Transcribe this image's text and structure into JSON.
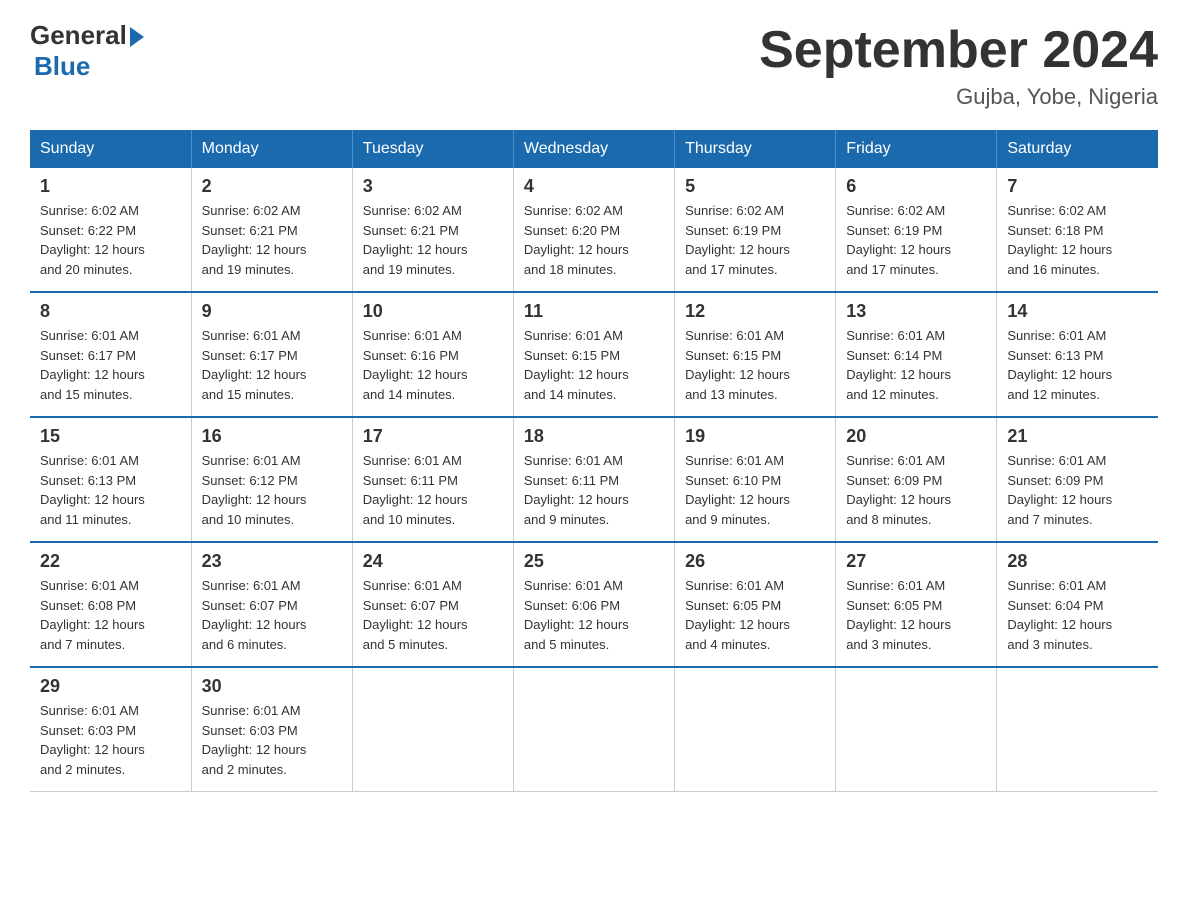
{
  "logo": {
    "general_text": "General",
    "blue_text": "Blue"
  },
  "title": "September 2024",
  "location": "Gujba, Yobe, Nigeria",
  "days_of_week": [
    "Sunday",
    "Monday",
    "Tuesday",
    "Wednesday",
    "Thursday",
    "Friday",
    "Saturday"
  ],
  "weeks": [
    [
      {
        "day": "1",
        "sunrise": "6:02 AM",
        "sunset": "6:22 PM",
        "daylight": "12 hours and 20 minutes."
      },
      {
        "day": "2",
        "sunrise": "6:02 AM",
        "sunset": "6:21 PM",
        "daylight": "12 hours and 19 minutes."
      },
      {
        "day": "3",
        "sunrise": "6:02 AM",
        "sunset": "6:21 PM",
        "daylight": "12 hours and 19 minutes."
      },
      {
        "day": "4",
        "sunrise": "6:02 AM",
        "sunset": "6:20 PM",
        "daylight": "12 hours and 18 minutes."
      },
      {
        "day": "5",
        "sunrise": "6:02 AM",
        "sunset": "6:19 PM",
        "daylight": "12 hours and 17 minutes."
      },
      {
        "day": "6",
        "sunrise": "6:02 AM",
        "sunset": "6:19 PM",
        "daylight": "12 hours and 17 minutes."
      },
      {
        "day": "7",
        "sunrise": "6:02 AM",
        "sunset": "6:18 PM",
        "daylight": "12 hours and 16 minutes."
      }
    ],
    [
      {
        "day": "8",
        "sunrise": "6:01 AM",
        "sunset": "6:17 PM",
        "daylight": "12 hours and 15 minutes."
      },
      {
        "day": "9",
        "sunrise": "6:01 AM",
        "sunset": "6:17 PM",
        "daylight": "12 hours and 15 minutes."
      },
      {
        "day": "10",
        "sunrise": "6:01 AM",
        "sunset": "6:16 PM",
        "daylight": "12 hours and 14 minutes."
      },
      {
        "day": "11",
        "sunrise": "6:01 AM",
        "sunset": "6:15 PM",
        "daylight": "12 hours and 14 minutes."
      },
      {
        "day": "12",
        "sunrise": "6:01 AM",
        "sunset": "6:15 PM",
        "daylight": "12 hours and 13 minutes."
      },
      {
        "day": "13",
        "sunrise": "6:01 AM",
        "sunset": "6:14 PM",
        "daylight": "12 hours and 12 minutes."
      },
      {
        "day": "14",
        "sunrise": "6:01 AM",
        "sunset": "6:13 PM",
        "daylight": "12 hours and 12 minutes."
      }
    ],
    [
      {
        "day": "15",
        "sunrise": "6:01 AM",
        "sunset": "6:13 PM",
        "daylight": "12 hours and 11 minutes."
      },
      {
        "day": "16",
        "sunrise": "6:01 AM",
        "sunset": "6:12 PM",
        "daylight": "12 hours and 10 minutes."
      },
      {
        "day": "17",
        "sunrise": "6:01 AM",
        "sunset": "6:11 PM",
        "daylight": "12 hours and 10 minutes."
      },
      {
        "day": "18",
        "sunrise": "6:01 AM",
        "sunset": "6:11 PM",
        "daylight": "12 hours and 9 minutes."
      },
      {
        "day": "19",
        "sunrise": "6:01 AM",
        "sunset": "6:10 PM",
        "daylight": "12 hours and 9 minutes."
      },
      {
        "day": "20",
        "sunrise": "6:01 AM",
        "sunset": "6:09 PM",
        "daylight": "12 hours and 8 minutes."
      },
      {
        "day": "21",
        "sunrise": "6:01 AM",
        "sunset": "6:09 PM",
        "daylight": "12 hours and 7 minutes."
      }
    ],
    [
      {
        "day": "22",
        "sunrise": "6:01 AM",
        "sunset": "6:08 PM",
        "daylight": "12 hours and 7 minutes."
      },
      {
        "day": "23",
        "sunrise": "6:01 AM",
        "sunset": "6:07 PM",
        "daylight": "12 hours and 6 minutes."
      },
      {
        "day": "24",
        "sunrise": "6:01 AM",
        "sunset": "6:07 PM",
        "daylight": "12 hours and 5 minutes."
      },
      {
        "day": "25",
        "sunrise": "6:01 AM",
        "sunset": "6:06 PM",
        "daylight": "12 hours and 5 minutes."
      },
      {
        "day": "26",
        "sunrise": "6:01 AM",
        "sunset": "6:05 PM",
        "daylight": "12 hours and 4 minutes."
      },
      {
        "day": "27",
        "sunrise": "6:01 AM",
        "sunset": "6:05 PM",
        "daylight": "12 hours and 3 minutes."
      },
      {
        "day": "28",
        "sunrise": "6:01 AM",
        "sunset": "6:04 PM",
        "daylight": "12 hours and 3 minutes."
      }
    ],
    [
      {
        "day": "29",
        "sunrise": "6:01 AM",
        "sunset": "6:03 PM",
        "daylight": "12 hours and 2 minutes."
      },
      {
        "day": "30",
        "sunrise": "6:01 AM",
        "sunset": "6:03 PM",
        "daylight": "12 hours and 2 minutes."
      },
      null,
      null,
      null,
      null,
      null
    ]
  ],
  "labels": {
    "sunrise": "Sunrise:",
    "sunset": "Sunset:",
    "daylight": "Daylight:"
  }
}
